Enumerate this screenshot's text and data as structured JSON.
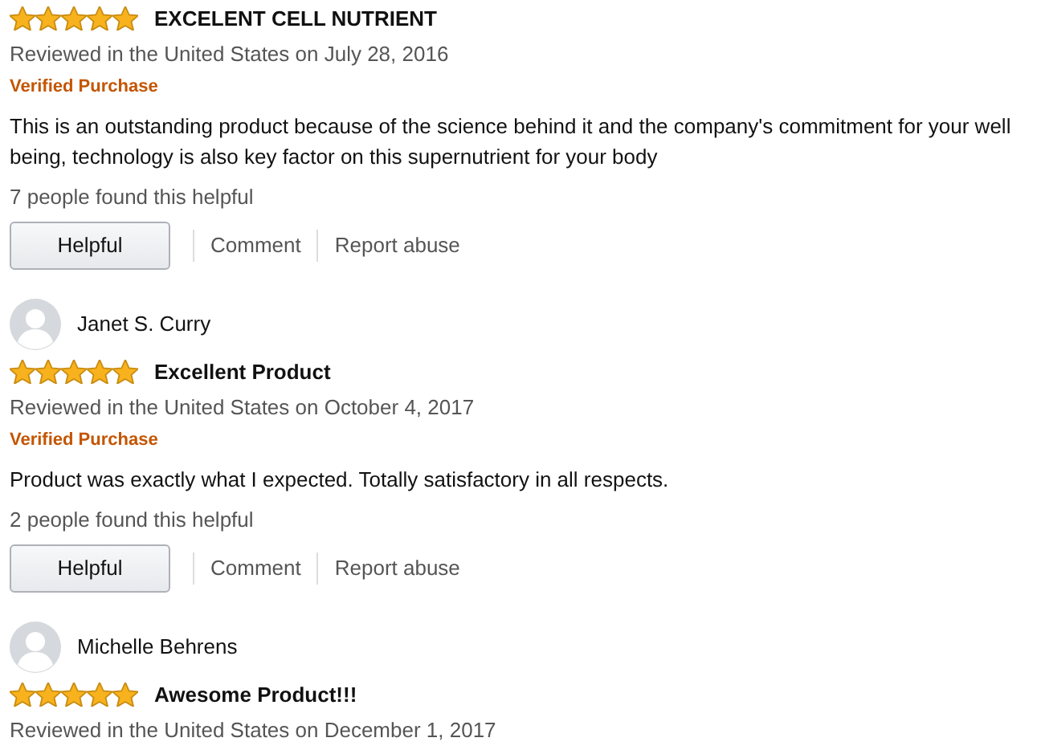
{
  "reviews": [
    {
      "stars": 5,
      "title": "EXCELENT CELL NUTRIENT",
      "meta": "Reviewed in the United States on July 28, 2016",
      "badge": "Verified Purchase",
      "body": "This is an outstanding product because of the science behind it and the company's commitment for your well being, technology is also key factor on this supernutrient for your body",
      "helpful_count": "7 people found this helpful",
      "actions": [
        "Helpful",
        "Comment",
        "Report abuse"
      ]
    },
    {
      "author": "Janet S. Curry",
      "stars": 5,
      "title": "Excellent Product",
      "meta": "Reviewed in the United States on October 4, 2017",
      "badge": "Verified Purchase",
      "body": "Product was exactly what I expected. Totally satisfactory in all respects.",
      "helpful_count": "2 people found this helpful",
      "actions": [
        "Helpful",
        "Comment",
        "Report abuse"
      ]
    },
    {
      "author": "Michelle Behrens",
      "stars": 5,
      "title": "Awesome Product!!!",
      "meta": "Reviewed in the United States on December 1, 2017"
    }
  ]
}
